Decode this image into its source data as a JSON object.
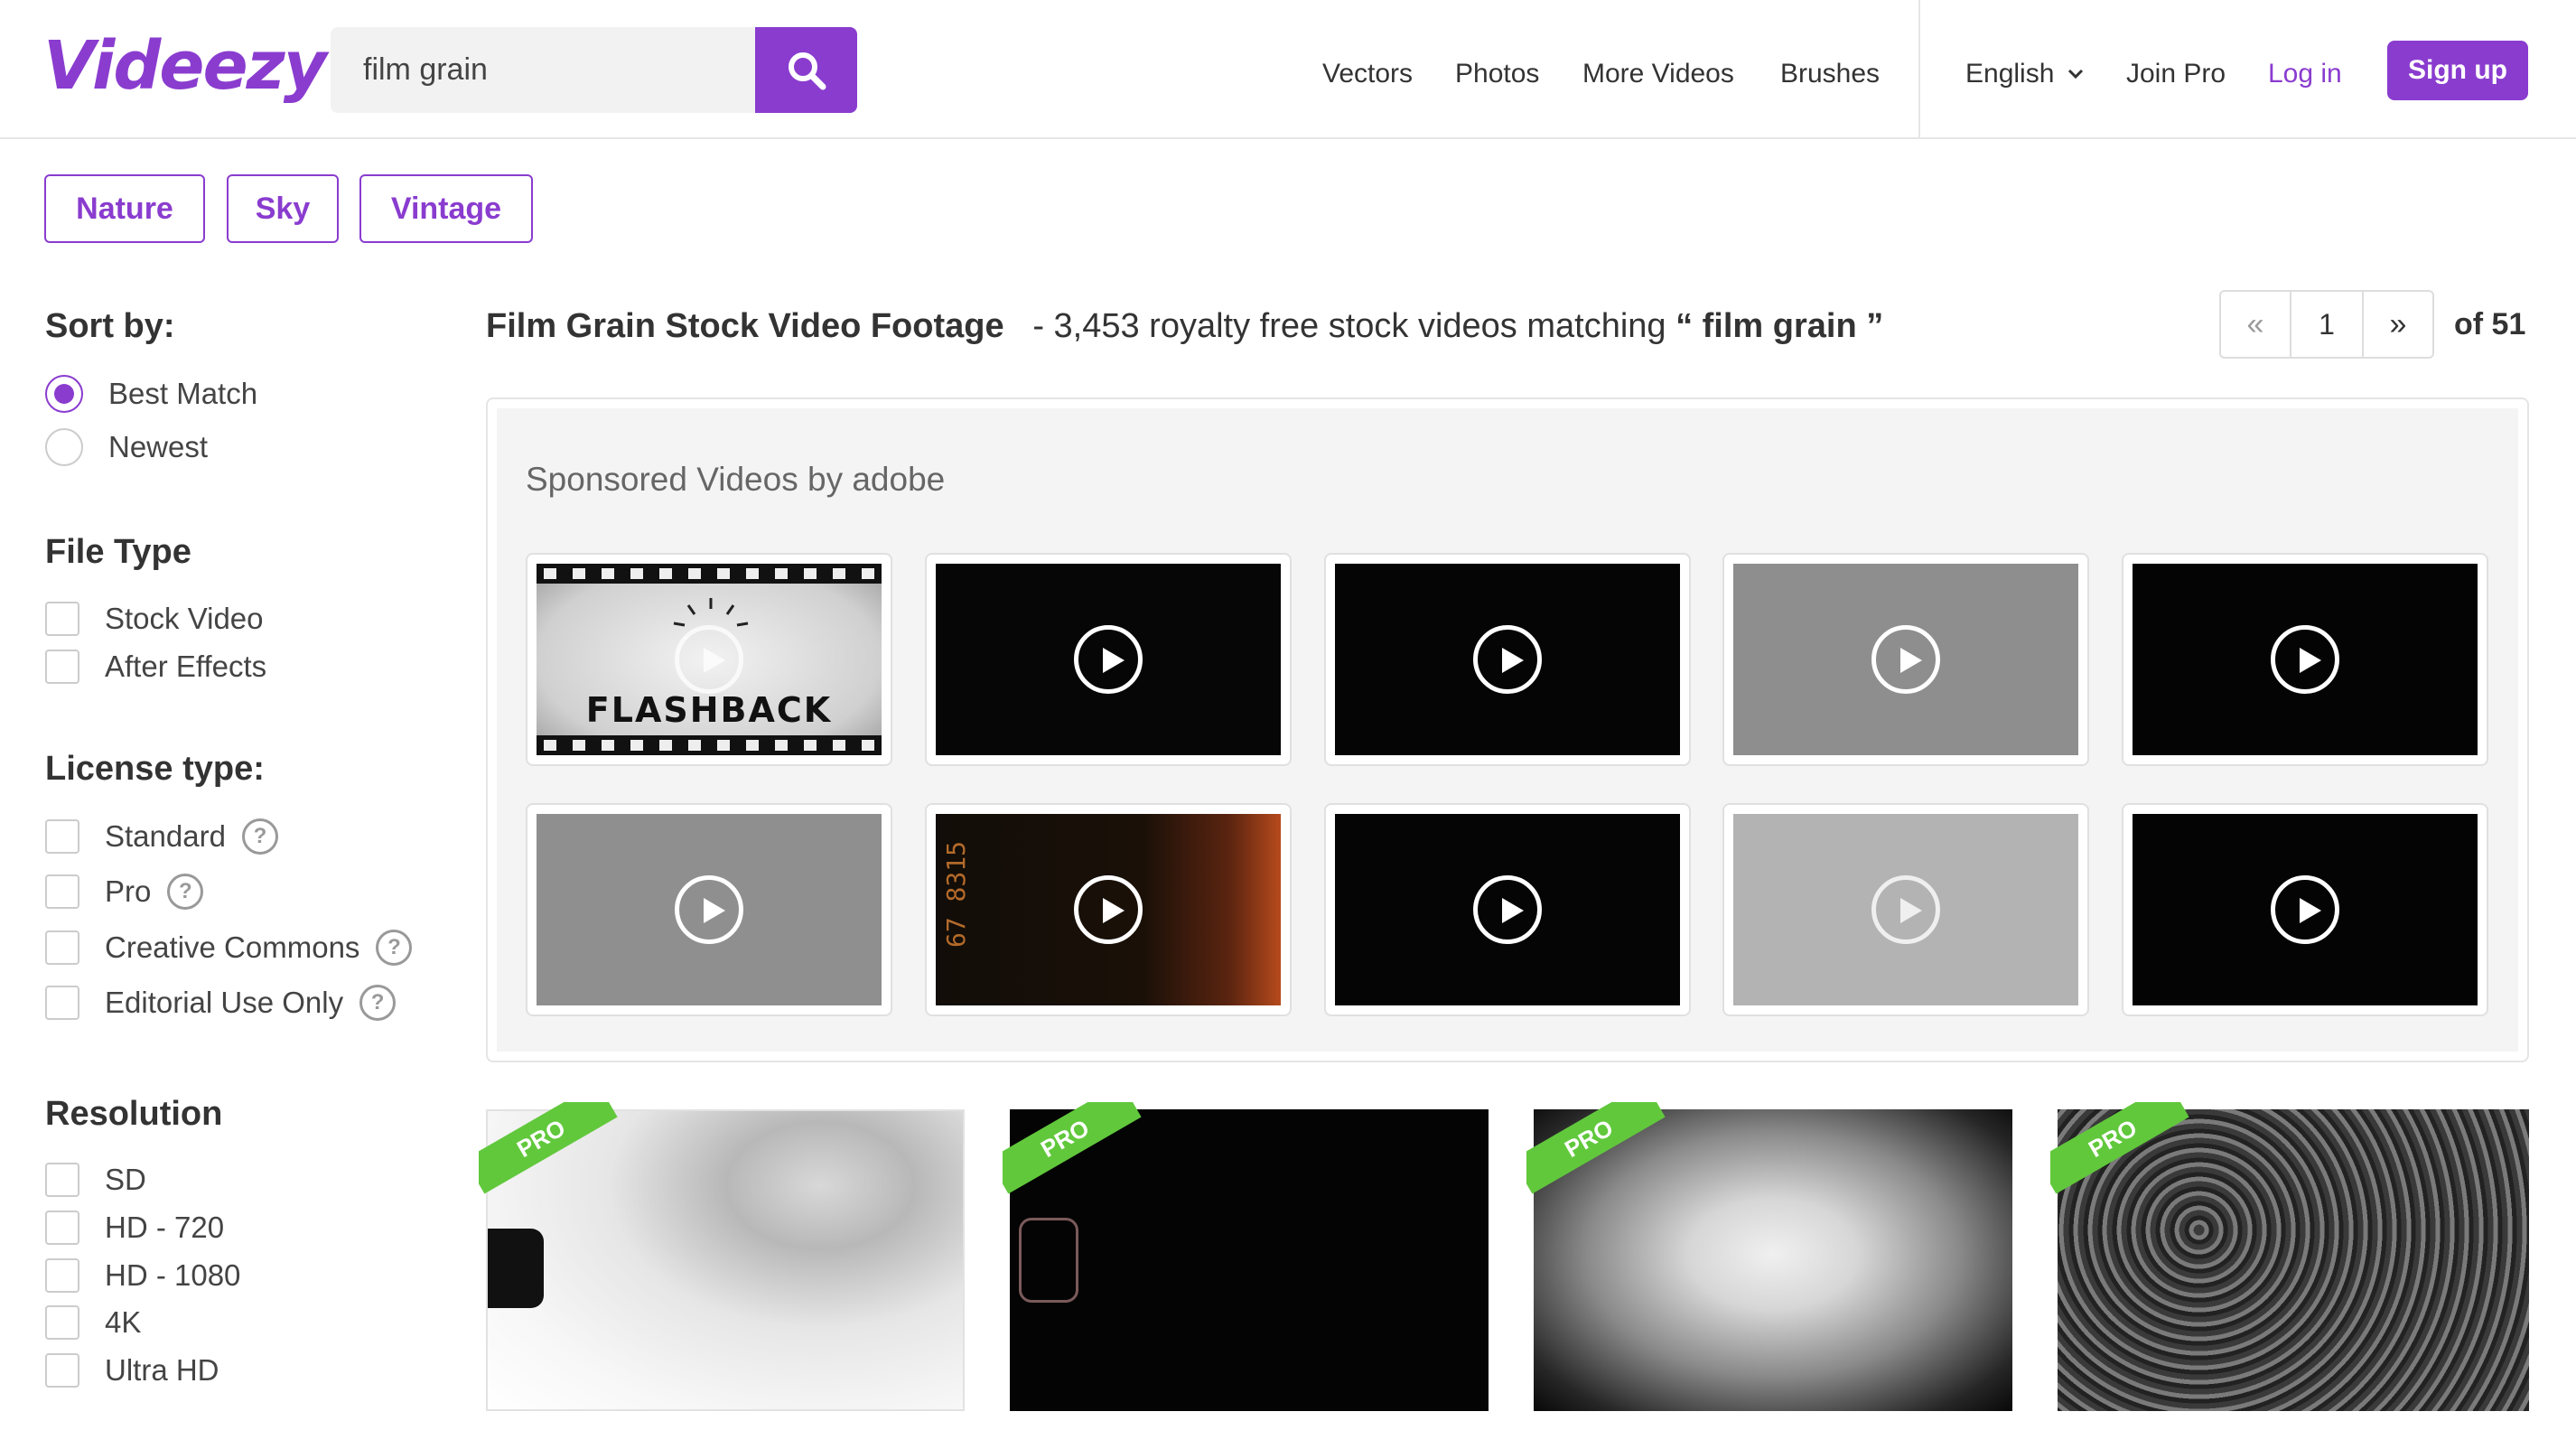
{
  "header": {
    "logo": "Videezy",
    "search_value": "film grain",
    "nav": [
      "Vectors",
      "Photos",
      "More Videos",
      "Brushes"
    ],
    "language": "English",
    "join_pro": "Join Pro",
    "login": "Log in",
    "signup": "Sign up"
  },
  "tags": [
    "Nature",
    "Sky",
    "Vintage"
  ],
  "sidebar": {
    "sort_heading": "Sort by:",
    "sort_options": [
      "Best Match",
      "Newest"
    ],
    "sort_selected": "Best Match",
    "file_type_heading": "File Type",
    "file_types": [
      "Stock Video",
      "After Effects"
    ],
    "license_heading": "License type:",
    "licenses": [
      "Standard",
      "Pro",
      "Creative Commons",
      "Editorial Use Only"
    ],
    "help_glyph": "?",
    "resolution_heading": "Resolution",
    "resolutions": [
      "SD",
      "HD - 720",
      "HD - 1080",
      "4K",
      "Ultra HD"
    ]
  },
  "results": {
    "title": "Film Grain Stock Video Footage",
    "summary": "- 3,453 royalty free stock videos matching",
    "query_open": "“ film grain ”",
    "page": "1",
    "of_total": "of 51",
    "prev_glyph": "«",
    "next_glyph": "»"
  },
  "sponsored": {
    "label": "Sponsored Videos by adobe",
    "flashback_text": "FLASHBACK",
    "filmstrip_code": "67 8315"
  },
  "pro_badge": "PRO",
  "colors": {
    "accent": "#8a3ccf",
    "pro_green": "#61c83c"
  }
}
